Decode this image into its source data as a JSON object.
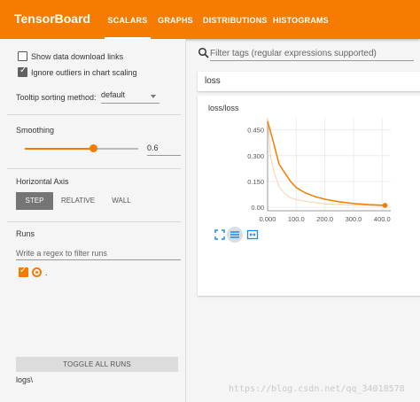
{
  "header": {
    "brand": "TensorBoard",
    "tabs": [
      {
        "label": "SCALARS",
        "active": true
      },
      {
        "label": "GRAPHS",
        "active": false
      },
      {
        "label": "DISTRIBUTIONS",
        "active": false
      },
      {
        "label": "HISTOGRAMS",
        "active": false
      }
    ],
    "bar_color": "#f57c00"
  },
  "sidebar": {
    "show_download_label": "Show data download links",
    "show_download_checked": false,
    "ignore_outliers_label": "Ignore outliers in chart scaling",
    "ignore_outliers_checked": true,
    "tooltip_label": "Tooltip sorting method:",
    "tooltip_value": "default",
    "smoothing_title": "Smoothing",
    "smoothing_value": "0.6",
    "smoothing_fraction": 0.6,
    "axis_title": "Horizontal Axis",
    "axis_options": [
      "STEP",
      "RELATIVE",
      "WALL"
    ],
    "axis_selected": "STEP",
    "runs_title": "Runs",
    "runs_placeholder": "Write a regex to filter runs",
    "run_label": ".",
    "toggle_all_label": "TOGGLE ALL RUNS",
    "logdir": "logs\\"
  },
  "main": {
    "search_placeholder": "Filter tags (regular expressions supported)",
    "group_name": "loss",
    "card_title": "loss/loss",
    "icons": [
      "fullscreen-icon",
      "list-icon",
      "fit-domain-icon"
    ]
  },
  "watermark": "https://blog.csdn.net/qq_34018578",
  "chart_data": {
    "type": "line",
    "title": "loss/loss",
    "xlim": [
      0,
      430
    ],
    "ylim": [
      -0.02,
      0.52
    ],
    "x_ticks": [
      "0.000",
      "100.0",
      "200.0",
      "300.0",
      "400.0"
    ],
    "y_ticks": [
      "0.00",
      "0.150",
      "0.300",
      "0.450"
    ],
    "x_tick_values": [
      0,
      100,
      200,
      300,
      400
    ],
    "y_tick_values": [
      0,
      0.15,
      0.3,
      0.45
    ],
    "series": [
      {
        "name": "smoothed",
        "color": "#f57c00",
        "x": [
          0,
          20,
          40,
          60,
          80,
          100,
          130,
          160,
          200,
          250,
          300,
          350,
          400,
          410
        ],
        "y": [
          0.5,
          0.38,
          0.25,
          0.2,
          0.15,
          0.115,
          0.085,
          0.065,
          0.047,
          0.032,
          0.022,
          0.016,
          0.012,
          0.011
        ]
      },
      {
        "name": "raw",
        "color": "#fbd0a8",
        "x": [
          0,
          10,
          20,
          40,
          60,
          80,
          100,
          150,
          200,
          300,
          400,
          410
        ],
        "y": [
          0.52,
          0.3,
          0.22,
          0.12,
          0.08,
          0.055,
          0.045,
          0.03,
          0.02,
          0.012,
          0.008,
          0.008
        ]
      }
    ]
  }
}
